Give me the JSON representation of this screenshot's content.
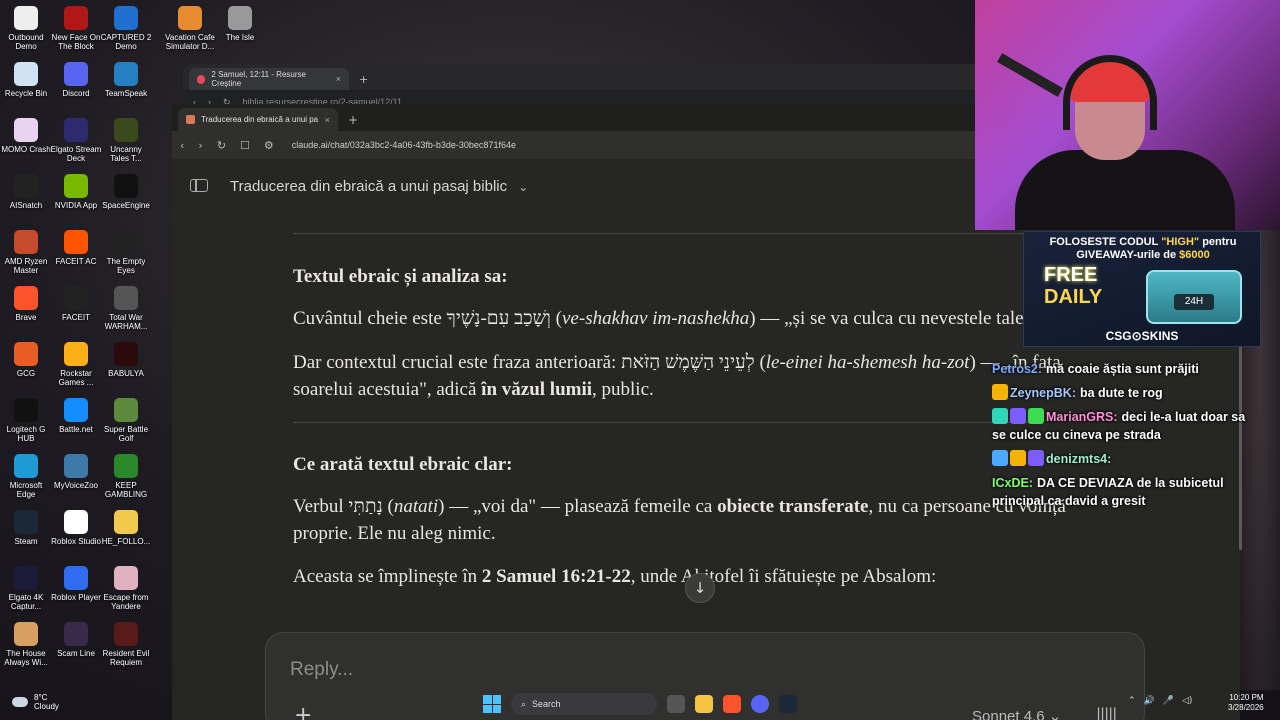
{
  "desktop_icons": [
    {
      "label": "Outbound Demo",
      "color": "#eeeeee"
    },
    {
      "label": "Recycle Bin",
      "color": "#cfe3f2"
    },
    {
      "label": "MOMO Crash",
      "color": "#e8d3f0"
    },
    {
      "label": "AISnatch",
      "color": "#222222"
    },
    {
      "label": "AMD Ryzen Master",
      "color": "#c44b2b"
    },
    {
      "label": "Brave",
      "color": "#fb542b"
    },
    {
      "label": "GCG",
      "color": "#e85d23"
    },
    {
      "label": "Logitech G HUB",
      "color": "#111111"
    },
    {
      "label": "Microsoft Edge",
      "color": "#1f9ad6"
    },
    {
      "label": "Steam",
      "color": "#1b2838"
    },
    {
      "label": "Elgato 4K Captur...",
      "color": "#1c1c3a"
    },
    {
      "label": "The House Always Wi...",
      "color": "#d8a060"
    },
    {
      "label": "New Face On The Block",
      "color": "#b01818"
    },
    {
      "label": "Discord",
      "color": "#5865f2"
    },
    {
      "label": "Elgato Stream Deck",
      "color": "#2e2a6e"
    },
    {
      "label": "NVIDIA App",
      "color": "#76b900"
    },
    {
      "label": "FACEIT AC",
      "color": "#ff5500"
    },
    {
      "label": "FACEIT",
      "color": "#222222"
    },
    {
      "label": "Rockstar Games ...",
      "color": "#fcaf17"
    },
    {
      "label": "Battle.net",
      "color": "#148eff"
    },
    {
      "label": "MyVoiceZoo",
      "color": "#3d7aa8"
    },
    {
      "label": "Roblox Studio",
      "color": "#ffffff"
    },
    {
      "label": "Roblox Player",
      "color": "#2f6cf0"
    },
    {
      "label": "Scam Line",
      "color": "#3a2a4a"
    },
    {
      "label": "CAPTURED 2 Demo",
      "color": "#1f6fcf"
    },
    {
      "label": "TeamSpeak",
      "color": "#2580c3"
    },
    {
      "label": "Uncanny Tales T...",
      "color": "#3a4a1a"
    },
    {
      "label": "SpaceEngine",
      "color": "#111111"
    },
    {
      "label": "The Empty Eyes",
      "color": "#222222"
    },
    {
      "label": "Total War WARHAM...",
      "color": "#555555"
    },
    {
      "label": "BABULYA",
      "color": "#2a0a0a"
    },
    {
      "label": "Super Battle Golf",
      "color": "#5a8a3a"
    },
    {
      "label": "KEEP GAMBLING",
      "color": "#2a8a2a"
    },
    {
      "label": "HE_FOLLO...",
      "color": "#f2c94c"
    },
    {
      "label": "Escape from Yandere",
      "color": "#e0b0c0"
    },
    {
      "label": "Resident Evil Requiem",
      "color": "#5a1a1a"
    }
  ],
  "desktop_partial_icons": [
    {
      "label": "Vacation Cafe Simulator D...",
      "color": "#e88a30"
    },
    {
      "label": "The Isle",
      "color": "#999999"
    }
  ],
  "back_window": {
    "tab_title": "2 Samuel, 12:11 - Resurse Creștine",
    "url": "biblia.resursecrestine.ro/2-samuel/12/11"
  },
  "browser": {
    "tab_title": "Traducerea din ebraică a unui pa",
    "url": "claude.ai/chat/032a3bc2-4a06-43fb-b3de-30bec871f64e",
    "close_glyph": "×",
    "newtab_glyph": "+"
  },
  "chat": {
    "title": "Traducerea din ebraică a unui pasaj biblic",
    "section1_title": "Textul ebraic și analiza sa:",
    "p1_a": "Cuvântul cheie este ",
    "p1_hebrew": "וְשָׁכַב עִם-נָשֶׁיךָ",
    "p1_b": " (",
    "p1_translit": "ve-shakhav im-nashekha",
    "p1_c": ") — „și se va culca cu nevestele tale.\"",
    "p2_a": "Dar contextul crucial este fraza anterioară: ",
    "p2_hebrew": "לְעֵינֵי הַשֶּׁמֶשׁ הַזֹּאת",
    "p2_b": " (",
    "p2_translit": "le-einei ha-shemesh ha-zot",
    "p2_c": ") — „în fața soarelui acestuia\", adică ",
    "p2_bold": "în văzul lumii",
    "p2_d": ", public.",
    "section2_title": "Ce arată textul ebraic clar:",
    "p3_a": "Verbul ",
    "p3_hebrew": "נָתַתִּי",
    "p3_b": " (",
    "p3_translit": "natati",
    "p3_c": ") — „voi da\" — plasează femeile ca ",
    "p3_bold": "obiecte transferate",
    "p3_d": ", nu ca persoane cu voință proprie. Ele nu aleg nimic.",
    "p4_a": "Aceasta se împlinește în ",
    "p4_bold": "2 Samuel 16:21-22",
    "p4_b": ", unde Ahitofel îi sfătuiește pe Absalom:",
    "reply_placeholder": "Reply...",
    "model": "Sonnet 4.6",
    "scroll_glyph": "↓",
    "plus_glyph": "+"
  },
  "ad": {
    "line1_a": "FOLOSESTE CODUL ",
    "line1_code": "\"HIGH\"",
    "line1_b": " pentru",
    "line2_a": "GIVEAWAY-urile de ",
    "line2_amount": "$6000",
    "free": "FREE",
    "daily": "DAILY",
    "box_tag": "24H",
    "brand": "CSG⊙SKINS"
  },
  "stream_chat": [
    {
      "user": "Petros2:",
      "color": "#7fa8ff",
      "text": "mă coaie ăștia sunt prăjiti",
      "badges": []
    },
    {
      "user": "ZeynepBK:",
      "color": "#a6c7ff",
      "text": "ba dute te rog",
      "badges": [
        "#f5b400"
      ]
    },
    {
      "user": "MarianGRS:",
      "color": "#ff8fd6",
      "text": "deci le-a luat doar sa se culce cu cineva pe strada",
      "badges": [
        "#2fd5b8",
        "#7a5cff",
        "#3ddc54"
      ]
    },
    {
      "user": "denizmts4:",
      "color": "#9ef0d0",
      "text": "",
      "badges": [
        "#4aa8ff",
        "#f5b400",
        "#7a5cff"
      ]
    },
    {
      "user": "ICxDE:",
      "color": "#7dff6a",
      "text": "DA CE DEVIAZA de la subicetul principal ca david a gresit",
      "badges": []
    }
  ],
  "taskbar": {
    "temp": "8°C",
    "weather": "Cloudy",
    "search": "Search",
    "time": "10:20 PM",
    "date": "3/28/2026"
  }
}
